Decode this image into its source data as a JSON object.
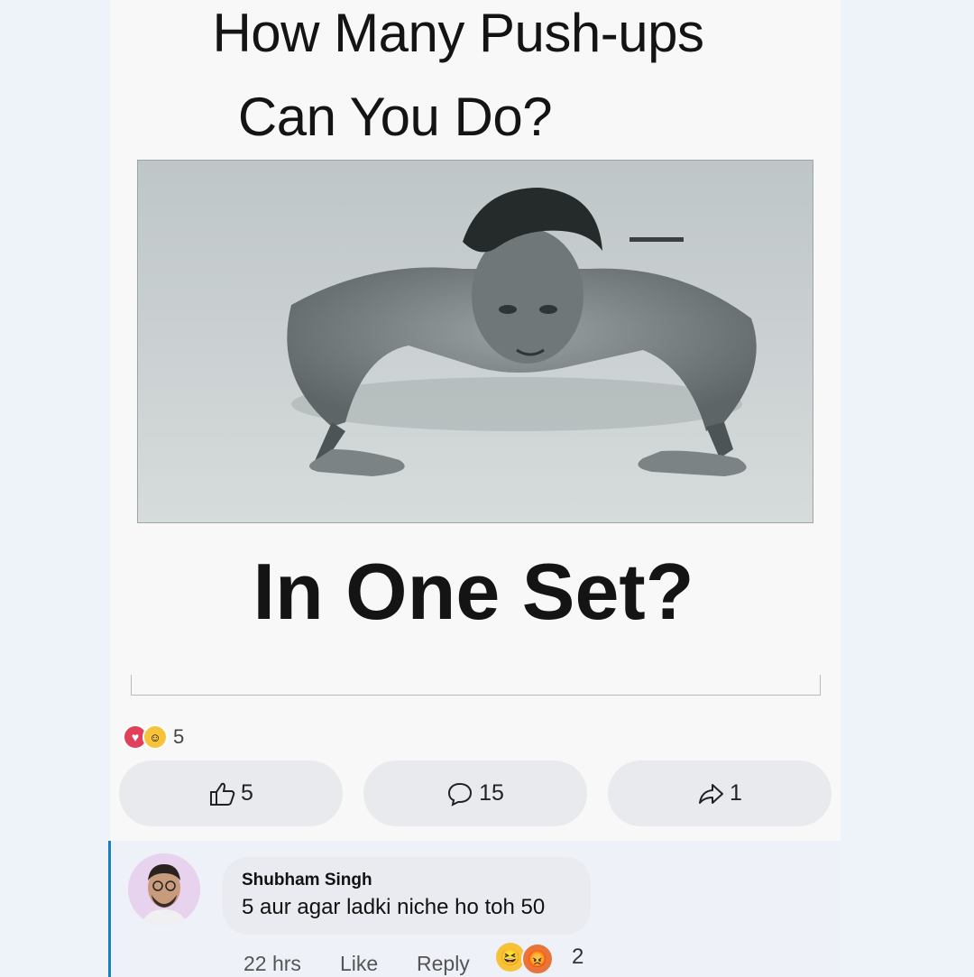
{
  "meme": {
    "title_line1": "How Many Push-ups",
    "title_line2": "Can You Do?",
    "caption": "In One Set?",
    "image_alt": "man doing a push-up"
  },
  "post": {
    "reaction_summary_count": "5",
    "reaction_icons": [
      "heart-icon",
      "care-icon"
    ],
    "actions": {
      "like_count": "5",
      "comment_count": "15",
      "share_count": "1"
    }
  },
  "comment": {
    "author": "Shubham Singh",
    "text": "5 aur agar ladki niche ho toh 50",
    "time": "22 hrs",
    "like_label": "Like",
    "reply_label": "Reply",
    "reaction_count": "2",
    "reaction_icons": [
      "laugh-icon",
      "angry-icon"
    ]
  },
  "colors": {
    "accent": "#1a7fbf",
    "heart": "#e0405a",
    "haha": "#f6c23a"
  }
}
